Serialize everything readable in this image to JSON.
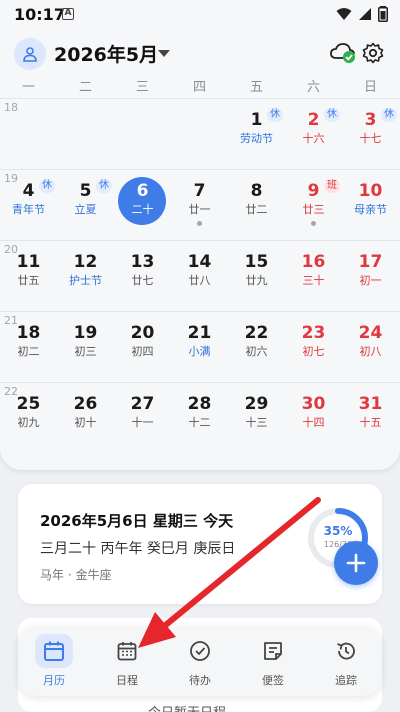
{
  "status_bar": {
    "time": "10:17",
    "notice": "A"
  },
  "header": {
    "month_title": "2026年5月"
  },
  "weekdays": [
    "一",
    "二",
    "三",
    "四",
    "五",
    "六",
    "日"
  ],
  "weeks": [
    {
      "num": "18",
      "days": [
        {
          "col": 4,
          "n": "1",
          "sub": "劳动节",
          "tag": "休",
          "tagType": "rest",
          "festival": true
        },
        {
          "col": 5,
          "n": "2",
          "sub": "十六",
          "tag": "休",
          "tagType": "rest",
          "weekend": true
        },
        {
          "col": 6,
          "n": "3",
          "sub": "十七",
          "tag": "休",
          "tagType": "rest",
          "weekend": true
        }
      ]
    },
    {
      "num": "19",
      "days": [
        {
          "col": 0,
          "n": "4",
          "sub": "青年节",
          "tag": "休",
          "tagType": "rest",
          "festival": true
        },
        {
          "col": 1,
          "n": "5",
          "sub": "立夏",
          "tag": "休",
          "tagType": "rest",
          "festival": true
        },
        {
          "col": 2,
          "n": "6",
          "sub": "二十",
          "today": true
        },
        {
          "col": 3,
          "n": "7",
          "sub": "廿一",
          "dot": true
        },
        {
          "col": 4,
          "n": "8",
          "sub": "廿二"
        },
        {
          "col": 5,
          "n": "9",
          "sub": "廿三",
          "tag": "班",
          "tagType": "work",
          "weekend": true,
          "dot": true
        },
        {
          "col": 6,
          "n": "10",
          "sub": "母亲节",
          "weekend": true,
          "festival": true
        }
      ]
    },
    {
      "num": "20",
      "days": [
        {
          "col": 0,
          "n": "11",
          "sub": "廿五"
        },
        {
          "col": 1,
          "n": "12",
          "sub": "护士节",
          "festival": true
        },
        {
          "col": 2,
          "n": "13",
          "sub": "廿七"
        },
        {
          "col": 3,
          "n": "14",
          "sub": "廿八"
        },
        {
          "col": 4,
          "n": "15",
          "sub": "廿九"
        },
        {
          "col": 5,
          "n": "16",
          "sub": "三十",
          "weekend": true
        },
        {
          "col": 6,
          "n": "17",
          "sub": "初一",
          "weekend": true
        }
      ]
    },
    {
      "num": "21",
      "days": [
        {
          "col": 0,
          "n": "18",
          "sub": "初二"
        },
        {
          "col": 1,
          "n": "19",
          "sub": "初三"
        },
        {
          "col": 2,
          "n": "20",
          "sub": "初四"
        },
        {
          "col": 3,
          "n": "21",
          "sub": "小满",
          "festival": true
        },
        {
          "col": 4,
          "n": "22",
          "sub": "初六"
        },
        {
          "col": 5,
          "n": "23",
          "sub": "初七",
          "weekend": true
        },
        {
          "col": 6,
          "n": "24",
          "sub": "初八",
          "weekend": true
        }
      ]
    },
    {
      "num": "22",
      "days": [
        {
          "col": 0,
          "n": "25",
          "sub": "初九"
        },
        {
          "col": 1,
          "n": "26",
          "sub": "初十"
        },
        {
          "col": 2,
          "n": "27",
          "sub": "十一"
        },
        {
          "col": 3,
          "n": "28",
          "sub": "十二"
        },
        {
          "col": 4,
          "n": "29",
          "sub": "十三"
        },
        {
          "col": 5,
          "n": "30",
          "sub": "十四",
          "weekend": true
        },
        {
          "col": 6,
          "n": "31",
          "sub": "十五",
          "weekend": true
        }
      ]
    }
  ],
  "info": {
    "date": "2026年5月6日 星期三 今天",
    "lunar": "三月二十 丙午年 癸巳月 庚辰日",
    "zodiac": "马年 · 金牛座",
    "progress_percent": "35%",
    "progress_fraction": 0.35,
    "progress_count": "126/36"
  },
  "peek_text": "今日暂无日程",
  "tabs": [
    {
      "label": "月历",
      "icon": "calendar-month-icon",
      "active": true
    },
    {
      "label": "日程",
      "icon": "calendar-schedule-icon"
    },
    {
      "label": "待办",
      "icon": "check-circle-icon"
    },
    {
      "label": "便签",
      "icon": "note-icon"
    },
    {
      "label": "追踪",
      "icon": "history-icon"
    }
  ],
  "colors": {
    "accent": "#3f7ce8",
    "weekend": "#e0383e",
    "festival": "#2f73d8",
    "annotation_arrow": "#e5262b"
  }
}
